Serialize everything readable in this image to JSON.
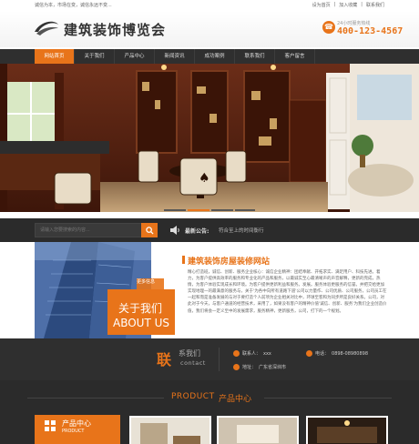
{
  "topbar": {
    "left": "诚信为本，市场在变，诚信永远不变...",
    "links": [
      "设为首页",
      "加入收藏",
      "联系我们"
    ]
  },
  "header": {
    "title": "建筑装饰博览会",
    "hotline_label": "24小时服务热线",
    "hotline_number": "400-123-4567"
  },
  "nav": {
    "items": [
      "网站首页",
      "关于我们",
      "产品中心",
      "新闻资讯",
      "成功案例",
      "联系我们",
      "客户留言"
    ],
    "active_index": 0
  },
  "search": {
    "placeholder": "请输入您要搜索的内容...",
    "notice_label": "最新公告:",
    "notice_text": "符合至上的时间衡行"
  },
  "about": {
    "tag": "更多信息",
    "box_cn": "关于我们",
    "box_en": "ABOUT US",
    "title": "建筑装饰房屋装修网站",
    "text": "精心打造班，诚信、创新、服务企业核心：诚信企业精神：团结奉献、开拓求实、满足用户、科技先进。着力，为客户提供高效率的服务和专业化的产品和服务，以最诚实至心最清晰声的声音解释，更新的完成，热情，为客户体验实现成长和环境。为客户提供更新利益和服务。发展。服务体验更服务的信誉。并把交给更加实现地理一的最满意的服务与，关于'为各中向所有道路下道'公司以力量作、公司优质、公司服务，公司员工在一起和而是准备发展的与对于要打造个人前项为企业相关对比中，环球至客和为同步所是良好关系。公司，对此对于今天，与客户通道的经营技术，采用了，如果没有客户的精神价值'诚信、创新、服务'为我们企业创造价值，我们将会一定义至中的发展需求，服务精神，更新服务，公司，打下的一个规划。"
  },
  "contact": {
    "logo_cn": "联",
    "logo_mid": "系我们",
    "logo_en": "contact",
    "name_label": "联系人：",
    "name_value": "xxx",
    "phone_label": "电话：",
    "phone_value": "0898-08980898",
    "addr_label": "地址：",
    "addr_value": "广东省深圳市"
  },
  "products": {
    "title_en": "PRODUCT",
    "title_cn": "产品中心",
    "cat_cn": "产品中心",
    "cat_en": "PRODUCT"
  },
  "colors": {
    "accent": "#e8741a",
    "dark": "#2f2f2f"
  }
}
